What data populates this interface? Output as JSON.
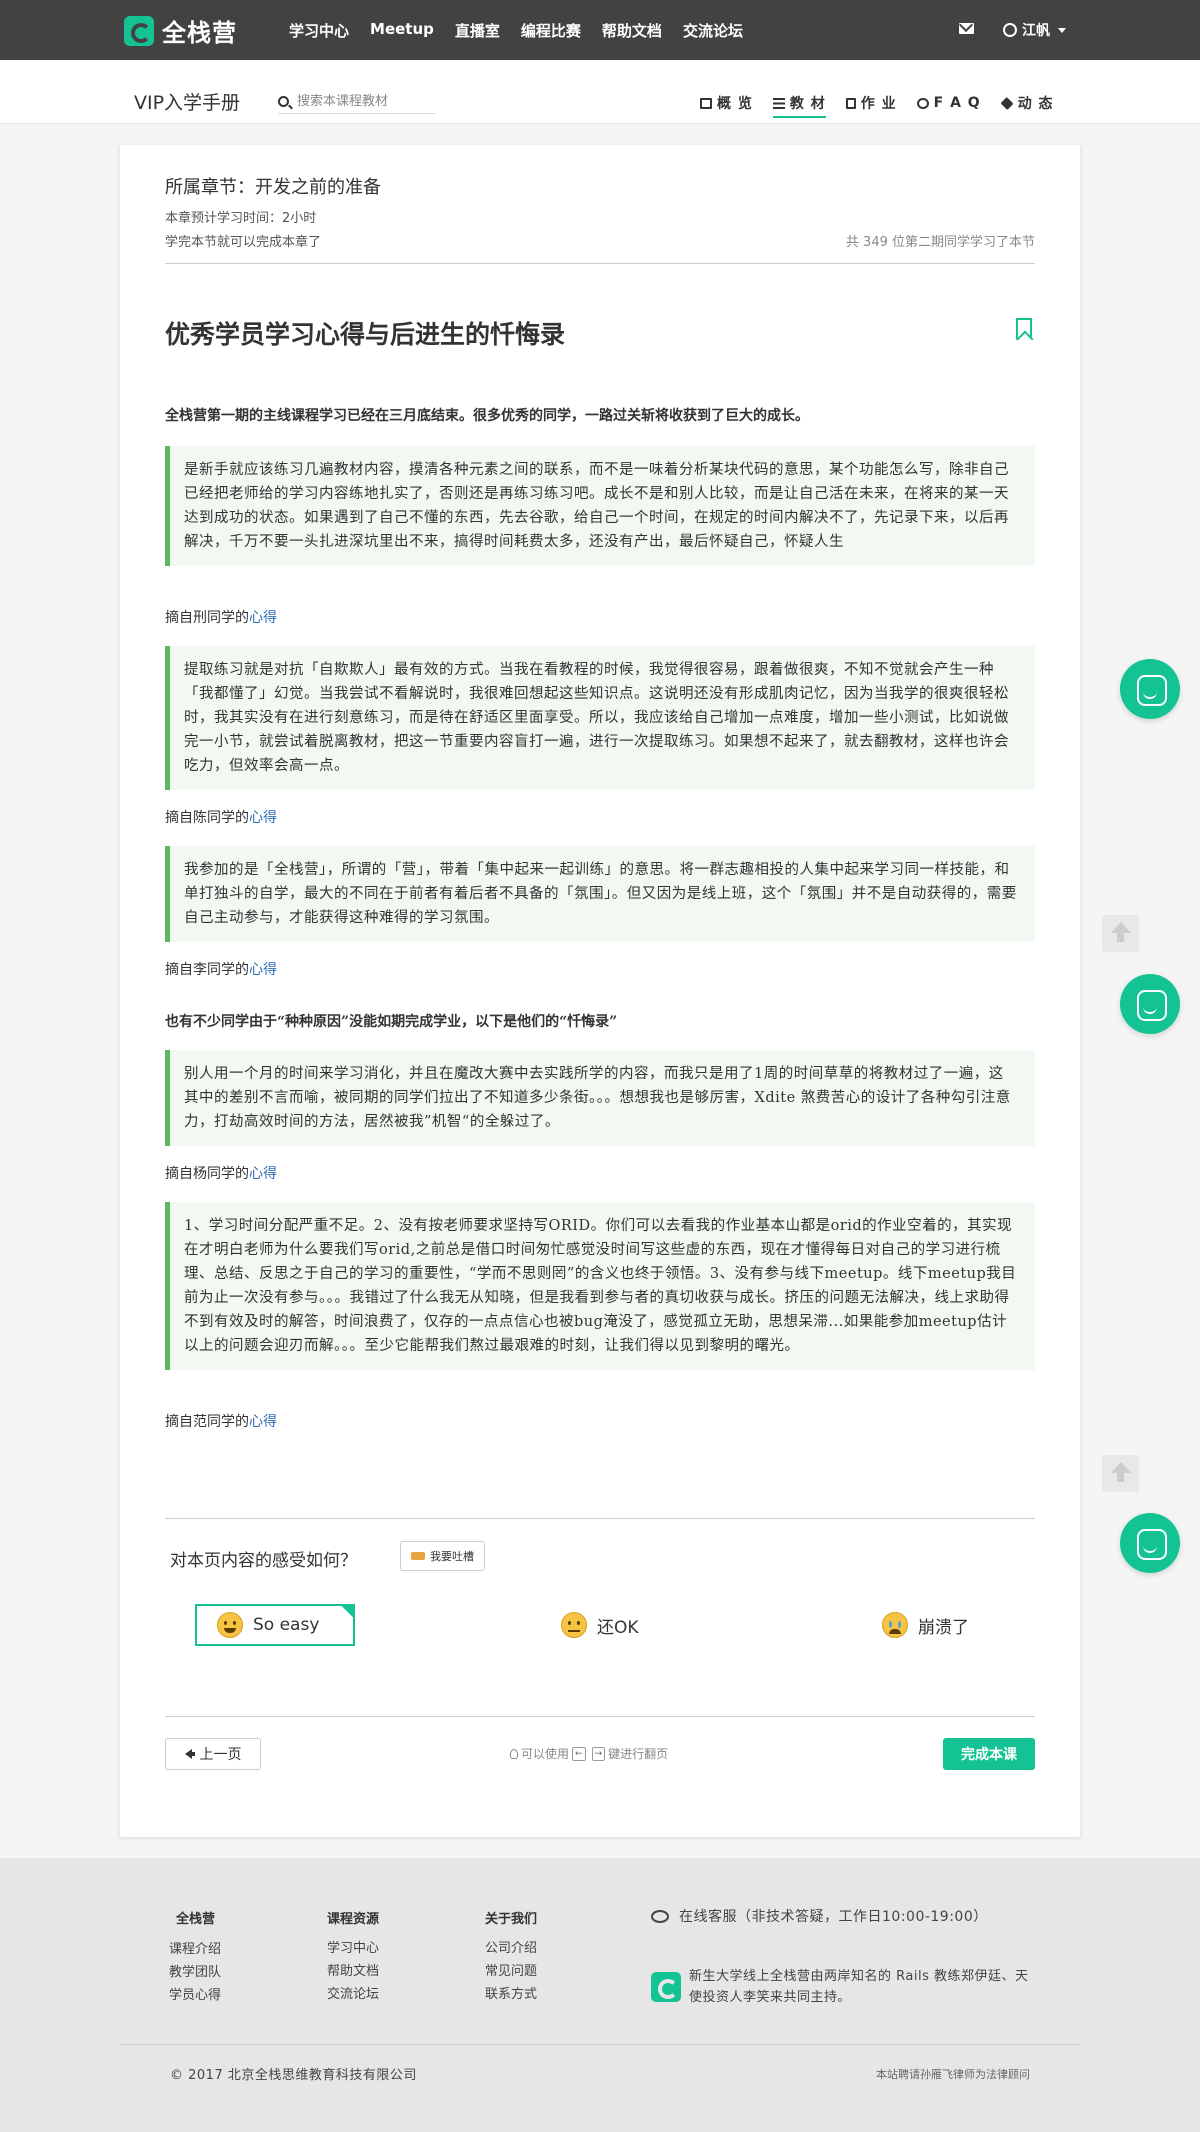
{
  "topnav": {
    "logo": "全栈营",
    "links": [
      "学习中心",
      "Meetup",
      "直播室",
      "编程比赛",
      "帮助文档",
      "交流论坛"
    ],
    "user": "江帆"
  },
  "subnav": {
    "title": "VIP入学手册",
    "search_placeholder": "搜索本课程教材",
    "tabs": [
      {
        "label": "概 览",
        "icon": "monitor-icon"
      },
      {
        "label": "教 材",
        "icon": "list-icon",
        "active": true
      },
      {
        "label": "作 业",
        "icon": "file-icon"
      },
      {
        "label": "F A Q",
        "icon": "chat-icon"
      },
      {
        "label": "动 态",
        "icon": "tag-icon"
      }
    ]
  },
  "chapter": {
    "label": "所属章节：",
    "name": "开发之前的准备",
    "time": "本章预计学习时间：2小时",
    "complete_note": "学完本节就可以完成本章了",
    "learners": "共 349 位第二期同学学习了本节"
  },
  "article": {
    "title": "优秀学员学习心得与后进生的忏悔录",
    "lead1": "全栈营第一期的主线课程学习已经在三月底结束。很多优秀的同学，一路过关斩将收获到了巨大的成长。",
    "lead2": "也有不少同学由于“种种原因”没能如期完成学业，以下是他们的“忏悔录”",
    "quotes": [
      {
        "text": "是新手就应该练习几遍教材内容，摸清各种元素之间的联系，而不是一味着分析某块代码的意思，某个功能怎么写，除非自己已经把老师给的学习内容练地扎实了，否则还是再练习练习吧。成长不是和别人比较，而是让自己活在未来，在将来的某一天达到成功的状态。如果遇到了自己不懂的东西，先去谷歌，给自己一个时间，在规定的时间内解决不了，先记录下来，以后再解决，千万不要一头扎进深坑里出不来，搞得时间耗费太多，还没有产出，最后怀疑自己，怀疑人生",
        "cite_prefix": "摘自刑同学的",
        "cite_link": "心得"
      },
      {
        "text": "提取练习就是对抗「自欺欺人」最有效的方式。当我在看教程的时候，我觉得很容易，跟着做很爽，不知不觉就会产生一种「我都懂了」幻觉。当我尝试不看解说时，我很难回想起这些知识点。这说明还没有形成肌肉记忆，因为当我学的很爽很轻松时，我其实没有在进行刻意练习，而是待在舒适区里面享受。所以，我应该给自己增加一点难度，增加一些小测试，比如说做完一小节，就尝试着脱离教材，把这一节重要内容盲打一遍，进行一次提取练习。如果想不起来了，就去翻教材，这样也许会吃力，但效率会高一点。",
        "cite_prefix": "摘自陈同学的",
        "cite_link": "心得"
      },
      {
        "text": "我参加的是「全栈营」，所谓的「营」，带着「集中起来一起训练」的意思。将一群志趣相投的人集中起来学习同一样技能，和单打独斗的自学，最大的不同在于前者有着后者不具备的「氛围」。但又因为是线上班，这个「氛围」并不是自动获得的，需要自己主动参与，才能获得这种难得的学习氛围。",
        "cite_prefix": "摘自李同学的",
        "cite_link": "心得"
      },
      {
        "text": "别人用一个月的时间来学习消化，并且在魔改大赛中去实践所学的内容，而我只是用了1周的时间草草的将教材过了一遍，这其中的差别不言而喻，被同期的同学们拉出了不知道多少条街。。。想想我也是够厉害，Xdite 煞费苦心的设计了各种勾引注意力，打劫高效时间的方法，居然被我”机智“的全躲过了。",
        "cite_prefix": "摘自杨同学的",
        "cite_link": "心得"
      },
      {
        "text": "1、学习时间分配严重不足。2、没有按老师要求坚持写ORID。你们可以去看我的作业基本山都是orid的作业空着的，其实现在才明白老师为什么要我们写orid,之前总是借口时间匆忙感觉没时间写这些虚的东西，现在才懂得每日对自己的学习进行梳理、总结、反思之于自己的学习的重要性，“学而不思则罔”的含义也终于领悟。3、没有参与线下meetup。线下meetup我目前为止一次没有参与。。。我错过了什么我无从知晓，但是我看到参与者的真切收获与成长。挤压的问题无法解决，线上求助得不到有效及时的解答，时间浪费了，仅存的一点点信心也被bug淹没了，感觉孤立无助，思想呆滞...如果能参加meetup估计以上的问题会迎刃而解。。。至少它能帮我们熬过最艰难的时刻，让我们得以见到黎明的曙光。",
        "cite_prefix": "摘自范同学的",
        "cite_link": "心得"
      }
    ]
  },
  "feedback": {
    "question": "对本页内容的感受如何？",
    "button": "我要吐槽",
    "options": [
      {
        "label": "So easy",
        "icon": "grin-face-icon",
        "selected": true
      },
      {
        "label": "还OK",
        "icon": "neutral-face-icon"
      },
      {
        "label": "崩溃了",
        "icon": "crying-face-icon"
      }
    ]
  },
  "pager": {
    "prev": "上一页",
    "hint_prefix": "可以使用",
    "key_left": "←",
    "key_right": "→",
    "hint_suffix": "键进行翻页",
    "finish": "完成本课"
  },
  "footer": {
    "columns": [
      {
        "heading": "全栈营",
        "items": [
          "课程介绍",
          "教学团队",
          "学员心得"
        ]
      },
      {
        "heading": "课程资源",
        "items": [
          "学习中心",
          "帮助文档",
          "交流论坛"
        ]
      },
      {
        "heading": "关于我们",
        "items": [
          "公司介绍",
          "常见问题",
          "联系方式"
        ]
      }
    ],
    "service": "在线客服（非技术答疑，工作日10:00-19:00）",
    "description": "新生大学线上全栈营由两岸知名的 Rails 教练郑伊廷、天使投资人李笑来共同主持。",
    "copyright": "© 2017 北京全栈思维教育科技有限公司",
    "legal": "本站聘请孙雁飞律师为法律顾问"
  },
  "colors": {
    "accent": "#14c393",
    "nav_bg": "#424242",
    "quote_border": "#5cb85c",
    "link": "#2e6bb5"
  }
}
